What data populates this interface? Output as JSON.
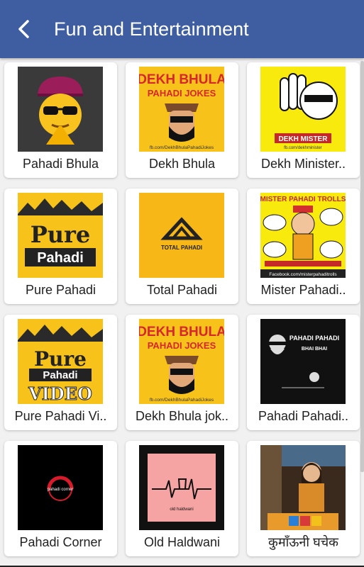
{
  "header": {
    "title": "Fun and Entertainment"
  },
  "items": [
    {
      "label": "Pahadi Bhula"
    },
    {
      "label": "Dekh Bhula"
    },
    {
      "label": "Dekh Minister.."
    },
    {
      "label": "Pure Pahadi"
    },
    {
      "label": "Total Pahadi"
    },
    {
      "label": "Mister Pahadi.."
    },
    {
      "label": "Pure Pahadi Vi.."
    },
    {
      "label": "Dekh Bhula jok.."
    },
    {
      "label": "Pahadi  Pahadi.."
    },
    {
      "label": "Pahadi Corner"
    },
    {
      "label": "Old Haldwani"
    },
    {
      "label": "कुमाँऊनी घचेक"
    }
  ],
  "thumbs": {
    "dekh_bhula": {
      "line1": "DEKH BHULA",
      "line2": "PAHADI JOKES",
      "footer": "fb.com/DekhBhulaPahadiJokes"
    },
    "dekh_minister": {
      "caption": "DEKH MISTER",
      "footer": "fb.com/dekhminister"
    },
    "pure_pahadi": {
      "line1": "Pure",
      "line2": "Pahadi"
    },
    "total_pahadi": {
      "caption": "TOTAL PAHADI"
    },
    "mister_pahadi": {
      "line1": "MISTER PAHADI TROLLS",
      "footer": "Facebook.com/misterpahaditrolls"
    },
    "pure_pahadi_video": {
      "line1": "Pure",
      "line2": "Pahadi",
      "line3": "VIDEO"
    },
    "pahadi_pahadi": {
      "line1": "PAHADI PAHADI",
      "line2": "BHAI BHAI"
    },
    "pahadi_corner": {
      "caption": "pahadi corner"
    },
    "old_haldwani": {
      "caption": "old haldwani"
    }
  },
  "colors": {
    "header": "#3e5ea1",
    "yellow": "#f7c21a"
  }
}
